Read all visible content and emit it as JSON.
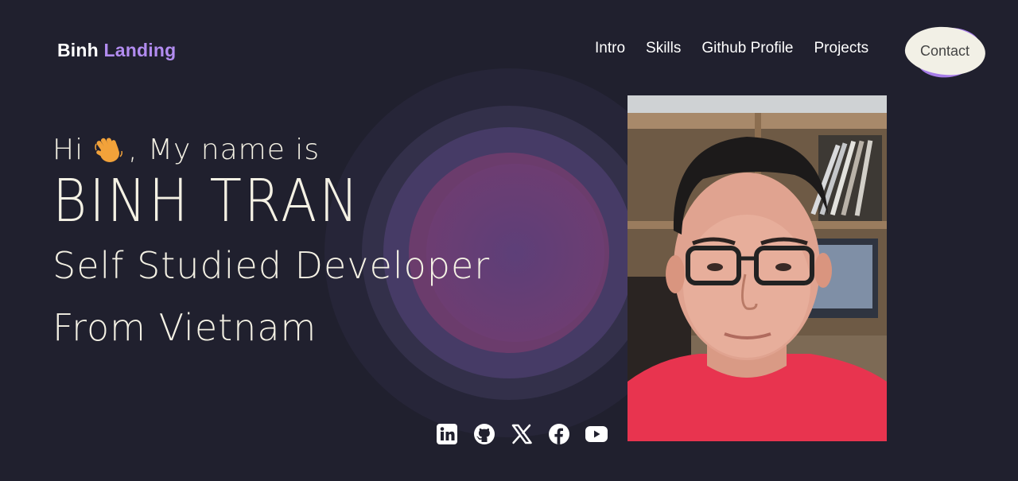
{
  "nav": {
    "logo_main": "Binh",
    "logo_accent": "Landing",
    "links": [
      "Intro",
      "Skills",
      "Github Profile",
      "Projects"
    ],
    "contact_label": "Contact"
  },
  "hero": {
    "greeting_pre": "Hi",
    "greeting_post": ", My name is",
    "name": "BINH TRAN",
    "role_line1": "Self Studied Developer",
    "role_line2": "From Vietnam"
  },
  "social": [
    "linkedin-icon",
    "github-icon",
    "x-icon",
    "facebook-icon",
    "youtube-icon"
  ],
  "colors": {
    "background": "#20202e",
    "accent": "#b28cf0",
    "contact_button": "#f2f0e6",
    "hero_text": "#f4f1e4"
  }
}
